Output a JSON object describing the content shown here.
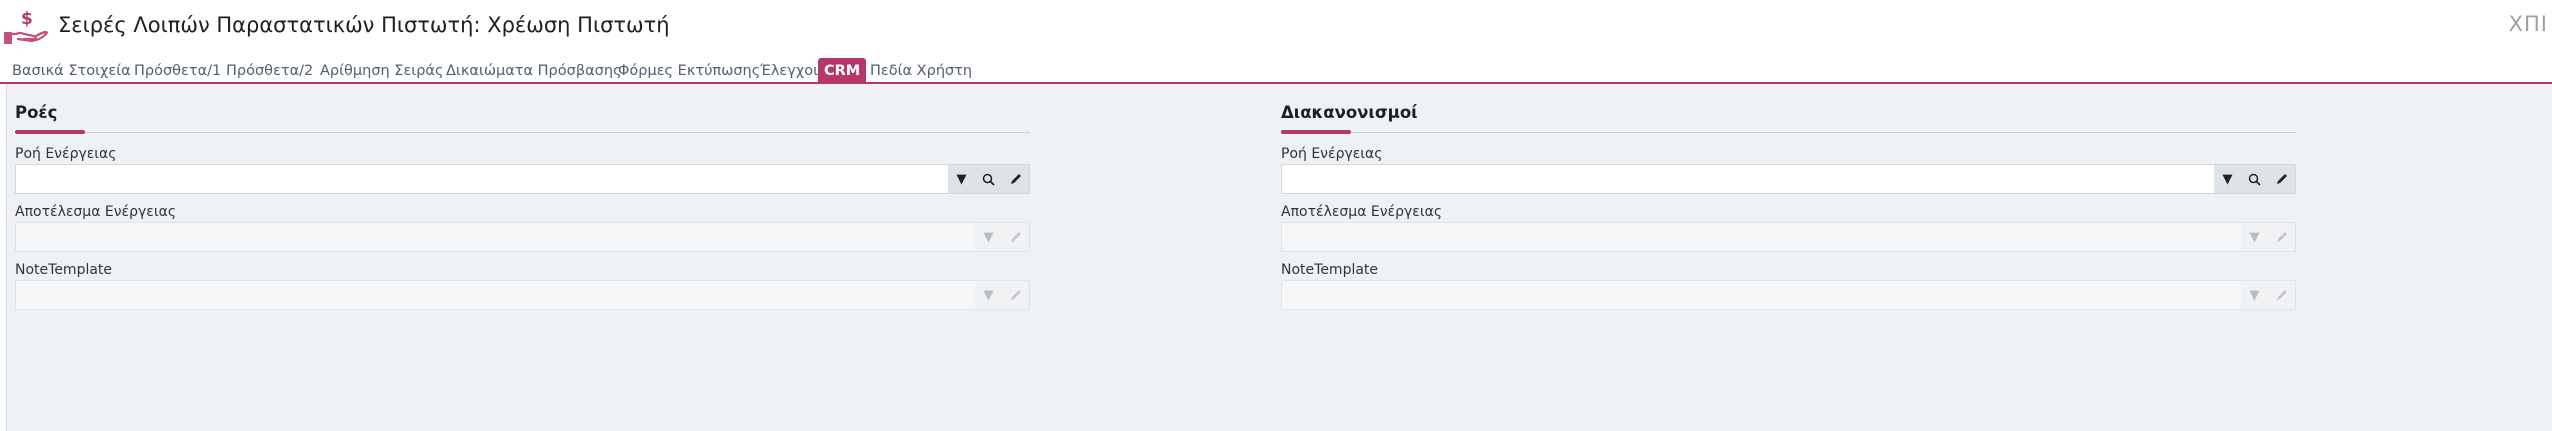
{
  "window": {
    "title": "Σειρές Λοιπών Παραστατικών Πιστωτή: Χρέωση Πιστωτή",
    "code": "ΧΠΙ"
  },
  "tabs": [
    {
      "label": "Βασικά Στοιχεία",
      "active": false
    },
    {
      "label": "Πρόσθετα/1",
      "active": false
    },
    {
      "label": "Πρόσθετα/2",
      "active": false
    },
    {
      "label": "Αρίθμηση Σειράς",
      "active": false
    },
    {
      "label": "Δικαιώματα Πρόσβασης",
      "active": false
    },
    {
      "label": "Φόρμες Εκτύπωσης",
      "active": false
    },
    {
      "label": "Έλεγχοι",
      "active": false
    },
    {
      "label": "CRM",
      "active": true
    },
    {
      "label": "Πεδία Χρήστη",
      "active": false
    }
  ],
  "sections": [
    {
      "title": "Ροές",
      "fields": [
        {
          "label": "Ροή Ενέργειας",
          "value": "",
          "enabled": true
        },
        {
          "label": "Αποτέλεσμα Ενέργειας",
          "value": "",
          "enabled": false
        },
        {
          "label": "NoteTemplate",
          "value": "",
          "enabled": false
        }
      ]
    },
    {
      "title": "Διακανονισμοί",
      "fields": [
        {
          "label": "Ροή Ενέργειας",
          "value": "",
          "enabled": true
        },
        {
          "label": "Αποτέλεσμα Ενέργειας",
          "value": "",
          "enabled": false
        },
        {
          "label": "NoteTemplate",
          "value": "",
          "enabled": false
        }
      ]
    }
  ],
  "colors": {
    "accent": "#b5376b",
    "tab_text": "#4f5f72",
    "content_bg": "#eff2f5"
  }
}
